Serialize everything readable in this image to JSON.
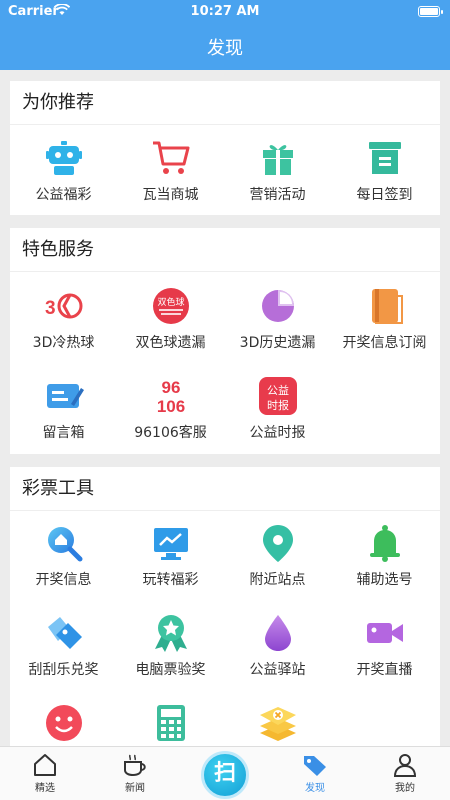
{
  "status": {
    "carrier": "Carrier",
    "time": "10:27 AM"
  },
  "header": {
    "title": "发现"
  },
  "sections": [
    {
      "title": "为你推荐",
      "items": [
        {
          "label": "公益福彩",
          "icon": "robot-icon"
        },
        {
          "label": "瓦当商城",
          "icon": "shopping-cart-icon"
        },
        {
          "label": "营销活动",
          "icon": "gift-icon"
        },
        {
          "label": "每日签到",
          "icon": "checkin-box-icon"
        }
      ]
    },
    {
      "title": "特色服务",
      "items": [
        {
          "label": "3D冷热球",
          "icon": "3d-logo-icon"
        },
        {
          "label": "双色球遗漏",
          "icon": "union-lotto-icon",
          "logo_text": "双色球"
        },
        {
          "label": "3D历史遗漏",
          "icon": "pie-chart-icon"
        },
        {
          "label": "开奖信息订阅",
          "icon": "book-icon"
        },
        {
          "label": "留言箱",
          "icon": "message-edit-icon"
        },
        {
          "label": "96106客服",
          "icon": "hotline-96106-icon",
          "logo_lines": [
            "96",
            "106"
          ]
        },
        {
          "label": "公益时报",
          "icon": "newspaper-icon",
          "logo_lines": [
            "公益",
            "时报"
          ]
        }
      ]
    },
    {
      "title": "彩票工具",
      "items": [
        {
          "label": "开奖信息",
          "icon": "magnifier-icon"
        },
        {
          "label": "玩转福彩",
          "icon": "monitor-chart-icon"
        },
        {
          "label": "附近站点",
          "icon": "location-pin-icon"
        },
        {
          "label": "辅助选号",
          "icon": "bell-icon"
        },
        {
          "label": "刮刮乐兑奖",
          "icon": "ticket-tags-icon"
        },
        {
          "label": "电脑票验奖",
          "icon": "award-ribbon-icon"
        },
        {
          "label": "公益驿站",
          "icon": "water-drop-icon"
        },
        {
          "label": "开奖直播",
          "icon": "video-camera-icon"
        },
        {
          "label": "",
          "icon": "smiley-icon"
        },
        {
          "label": "",
          "icon": "calculator-icon"
        },
        {
          "label": "",
          "icon": "layers-cancel-icon"
        }
      ]
    }
  ],
  "tabbar": {
    "items": [
      {
        "label": "精选",
        "icon": "home-icon"
      },
      {
        "label": "新闻",
        "icon": "coffee-cup-icon"
      },
      {
        "label": "发现",
        "icon": "tag-icon",
        "active": true
      },
      {
        "label": "我的",
        "icon": "user-icon"
      }
    ],
    "scan_label": "扫"
  }
}
